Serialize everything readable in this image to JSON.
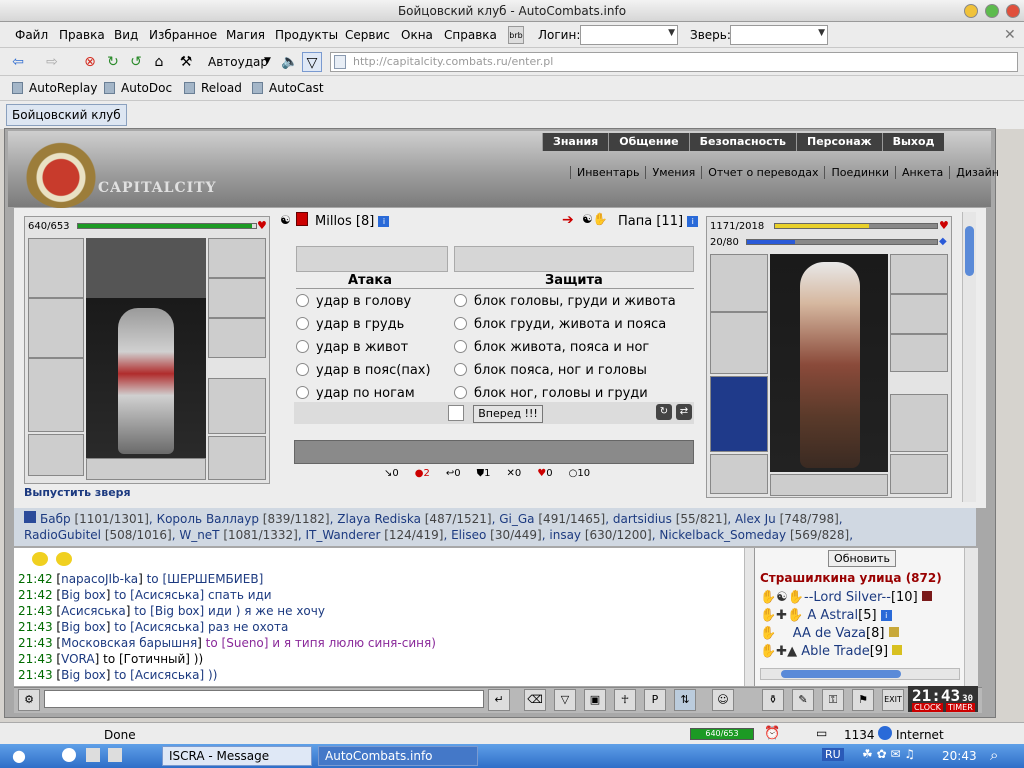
{
  "window": {
    "title": "Бойцовский клуб - AutoCombats.info"
  },
  "menu": [
    "Файл",
    "Правка",
    "Вид",
    "Избранное",
    "Магия",
    "Продукты",
    "Сервис",
    "Окна",
    "Справка"
  ],
  "login_label": "Логин:",
  "beast_label": "Зверь:",
  "autohit": "Автоудар",
  "url": "http://capitalcity.combats.ru/enter.pl",
  "bookmarks": [
    "AutoReplay",
    "AutoDoc",
    "Reload",
    "AutoCast"
  ],
  "tab": "Бойцовский клуб",
  "site": {
    "logo": "CAPITALCITY",
    "top_links": [
      "Знания",
      "Общение",
      "Безопасность",
      "Персонаж",
      "Выход"
    ],
    "sub_links": [
      "Инвентарь",
      "Умения",
      "Отчет о переводах",
      "Поединки",
      "Анкета",
      "Дизайн"
    ]
  },
  "fight": {
    "me": {
      "hp": "640/653",
      "hp_frac": 0.98,
      "name": "Millos",
      "level": "[8]"
    },
    "enemy": {
      "hp": "1171/2018",
      "hp_frac": 0.58,
      "mana": "20/80",
      "mana_frac": 0.25,
      "name": "Папа",
      "level": "[11]"
    },
    "attack_label": "Атака",
    "defense_label": "Защита",
    "attacks": [
      "удар в голову",
      "удар в грудь",
      "удар в живот",
      "удар в пояс(пах)",
      "удар по ногам"
    ],
    "blocks": [
      "блок головы, груди и живота",
      "блок груди, живота и пояса",
      "блок живота, пояса и ног",
      "блок пояса, ног и головы",
      "блок ног, головы и груди"
    ],
    "go": "Вперед !!!",
    "release_beast": "Выпустить зверя",
    "stats": [
      "0",
      "2",
      "0",
      "1",
      "0",
      "0",
      "10"
    ]
  },
  "online": [
    {
      "name": "Бабр",
      "hp": "[1101/1301]"
    },
    {
      "name": "Король Валлаур",
      "hp": "[839/1182]"
    },
    {
      "name": "Zlaya Rediska",
      "hp": "[487/1521]"
    },
    {
      "name": "Gi_Ga",
      "hp": "[491/1465]"
    },
    {
      "name": "dartsidius",
      "hp": "[55/821]"
    },
    {
      "name": "Alex Ju",
      "hp": "[748/798]"
    },
    {
      "name": "RadioGubitel",
      "hp": "[508/1016]"
    },
    {
      "name": "W_neT",
      "hp": "[1081/1332]"
    },
    {
      "name": "IT_Wanderer",
      "hp": "[124/419]"
    },
    {
      "name": "Eliseo",
      "hp": "[30/449]"
    },
    {
      "name": "insay",
      "hp": "[630/1200]"
    },
    {
      "name": "Nickelback_Someday",
      "hp": "[569/828]"
    }
  ],
  "chat": [
    {
      "time": "21:42",
      "from": "napacoJIb-ka",
      "text": "to [ШЕРШЕМБИЕВ]"
    },
    {
      "time": "21:42",
      "from": "Big box",
      "text": "to [Асисяська] спать иди"
    },
    {
      "time": "21:43",
      "from": "Асисяська",
      "text": "to [Big box] иди ) я же не хочу"
    },
    {
      "time": "21:43",
      "from": "Big box",
      "text": "to [Асисяська] раз не охота"
    },
    {
      "time": "21:43",
      "from": "Московская барышня",
      "text": "to [Sueno] и я типя люлю синя-синя)"
    },
    {
      "time": "21:43",
      "from": "VORA",
      "text": "to [Готичный] ))"
    },
    {
      "time": "21:43",
      "from": "Big box",
      "text": "to [Асисяська] ))"
    }
  ],
  "side": {
    "refresh": "Обновить",
    "street": "Страшилкина улица (872)",
    "players": [
      {
        "name": "--Lord Silver--",
        "lvl": "[10]"
      },
      {
        "name": "A Astral",
        "lvl": "[5]"
      },
      {
        "name": "AA de Vaza",
        "lvl": "[8]"
      },
      {
        "name": "Able Trade",
        "lvl": "[9]"
      }
    ]
  },
  "clock": "21:43",
  "clock_sec": "30",
  "clock_labels": [
    "CLOCK",
    "TIMER"
  ],
  "status": {
    "text": "Done",
    "hp": "640/653",
    "count": "1134",
    "zone": "Internet"
  },
  "taskbar": {
    "tasks": [
      "ISCRA - Message",
      "AutoCombats.info"
    ],
    "lang": "RU",
    "time": "20:43"
  }
}
